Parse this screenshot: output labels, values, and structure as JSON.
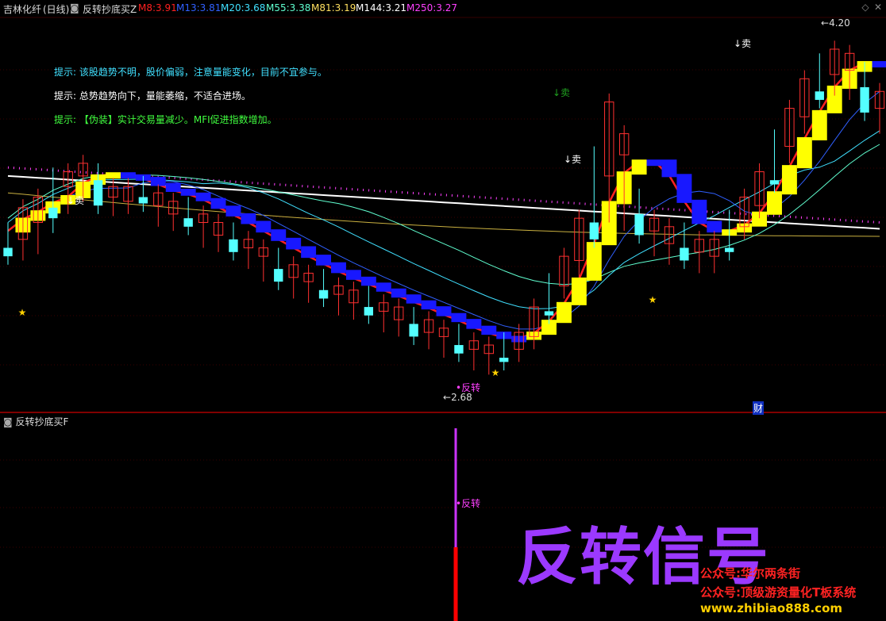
{
  "header": {
    "stock_name": "吉林化纤",
    "period": "(日线)",
    "indicator_name": "反转抄底买Z",
    "ma": [
      {
        "label": "M8:",
        "value": "3.91",
        "color": "#ff2020"
      },
      {
        "label": "M13:",
        "value": "3.81",
        "color": "#3060ff"
      },
      {
        "label": "M20:",
        "value": "3.68",
        "color": "#40e0ff"
      },
      {
        "label": "M55:",
        "value": "3.38",
        "color": "#60ffd0"
      },
      {
        "label": "M81:",
        "value": "3.19",
        "color": "#ffe060"
      },
      {
        "label": "M144:",
        "value": "3.21",
        "color": "#ffffff"
      },
      {
        "label": "M250:",
        "value": "3.27",
        "color": "#ff40ff"
      }
    ]
  },
  "hints": [
    {
      "prefix": "提示:",
      "text": "该股趋势不明，股价偏弱，注意量能变化，目前不宜参与。",
      "color": "#40e0ff"
    },
    {
      "prefix": "提示:",
      "text": "总势趋势向下，量能萎缩，不适合进场。",
      "color": "#ffffff"
    },
    {
      "prefix": "提示:",
      "text": "【伪装】实计交易量减少。MFI促进指数增加。",
      "color": "#40ff40"
    }
  ],
  "labels": {
    "sell_1": "↓卖",
    "sell_2": "↓卖",
    "sell_3": "↓卖",
    "sell_green": "↓卖",
    "reversal_main": "反转",
    "low_price": "2.68",
    "high_price": "4.20",
    "cai": "财",
    "reversal_sub": "反转"
  },
  "sub_panel": {
    "title": "反转抄底买F",
    "big_text": "反转信号"
  },
  "watermark": {
    "line1": "公众号:华尔两条街",
    "line2": "公众号:顶级游资量化T板系统",
    "line3": "www.zhibiao888.com"
  },
  "colors": {
    "up": "#ff3030",
    "down": "#54ffff",
    "ribbon_up": "#ffff00",
    "ribbon_down": "#1818ff",
    "signal_purple": "#cc33ff",
    "signal_red": "#ff0000"
  },
  "chart_data": {
    "type": "candlestick",
    "candles": [
      [
        3.26,
        3.34,
        3.22,
        3.2
      ],
      [
        3.3,
        3.45,
        3.24,
        3.22
      ],
      [
        3.38,
        3.5,
        3.3,
        3.25
      ],
      [
        3.45,
        3.6,
        3.4,
        3.35
      ],
      [
        3.55,
        3.62,
        3.48,
        3.44
      ],
      [
        3.6,
        3.66,
        3.52,
        3.5
      ],
      [
        3.58,
        3.62,
        3.46,
        3.44
      ],
      [
        3.5,
        3.55,
        3.45,
        3.43
      ],
      [
        3.48,
        3.55,
        3.46,
        3.44
      ],
      [
        3.5,
        3.56,
        3.47,
        3.45
      ],
      [
        3.46,
        3.52,
        3.4,
        3.38
      ],
      [
        3.42,
        3.48,
        3.38,
        3.36
      ],
      [
        3.4,
        3.46,
        3.36,
        3.34
      ],
      [
        3.38,
        3.42,
        3.3,
        3.28
      ],
      [
        3.32,
        3.38,
        3.28,
        3.26
      ],
      [
        3.3,
        3.34,
        3.24,
        3.22
      ],
      [
        3.26,
        3.3,
        3.2,
        3.18
      ],
      [
        3.22,
        3.26,
        3.14,
        3.12
      ],
      [
        3.16,
        3.22,
        3.1,
        3.08
      ],
      [
        3.12,
        3.18,
        3.06,
        3.04
      ],
      [
        3.1,
        3.14,
        3.04,
        3.02
      ],
      [
        3.06,
        3.12,
        3.02,
        3.0
      ],
      [
        3.04,
        3.08,
        2.98,
        2.96
      ],
      [
        3.0,
        3.06,
        2.96,
        2.94
      ],
      [
        2.98,
        3.04,
        2.94,
        2.92
      ],
      [
        2.96,
        3.0,
        2.9,
        2.88
      ],
      [
        2.92,
        2.98,
        2.88,
        2.86
      ],
      [
        2.9,
        2.94,
        2.84,
        2.82
      ],
      [
        2.86,
        2.92,
        2.82,
        2.8
      ],
      [
        2.84,
        2.88,
        2.78,
        2.76
      ],
      [
        2.8,
        2.86,
        2.76,
        2.74
      ],
      [
        2.78,
        2.82,
        2.74,
        2.7
      ],
      [
        2.76,
        2.8,
        2.7,
        2.68
      ],
      [
        2.74,
        2.82,
        2.72,
        2.7
      ],
      [
        2.78,
        2.86,
        2.76,
        2.74
      ],
      [
        2.84,
        2.98,
        2.82,
        2.8
      ],
      [
        2.96,
        3.1,
        2.94,
        2.92
      ],
      [
        3.08,
        3.22,
        3.06,
        3.04
      ],
      [
        3.2,
        3.4,
        3.18,
        3.14
      ],
      [
        3.38,
        3.7,
        3.3,
        3.28
      ],
      [
        3.6,
        3.95,
        3.5,
        3.4
      ],
      [
        3.7,
        3.8,
        3.4,
        3.36
      ],
      [
        3.42,
        3.5,
        3.32,
        3.3
      ],
      [
        3.34,
        3.4,
        3.26,
        3.24
      ],
      [
        3.28,
        3.36,
        3.22,
        3.2
      ],
      [
        3.26,
        3.34,
        3.2,
        3.18
      ],
      [
        3.24,
        3.3,
        3.18,
        3.16
      ],
      [
        3.22,
        3.3,
        3.18,
        3.16
      ],
      [
        3.26,
        3.4,
        3.24,
        3.22
      ],
      [
        3.36,
        3.5,
        3.34,
        3.32
      ],
      [
        3.46,
        3.62,
        3.44,
        3.42
      ],
      [
        3.58,
        3.78,
        3.56,
        3.54
      ],
      [
        3.74,
        3.92,
        3.7,
        3.68
      ],
      [
        3.88,
        4.06,
        3.84,
        3.82
      ],
      [
        4.0,
        4.14,
        3.96,
        3.94
      ],
      [
        4.08,
        4.2,
        4.02,
        4.0
      ],
      [
        4.1,
        4.18,
        4.0,
        3.98
      ],
      [
        4.02,
        4.1,
        3.9,
        3.88
      ],
      [
        3.92,
        4.0,
        3.84,
        3.82
      ]
    ]
  }
}
